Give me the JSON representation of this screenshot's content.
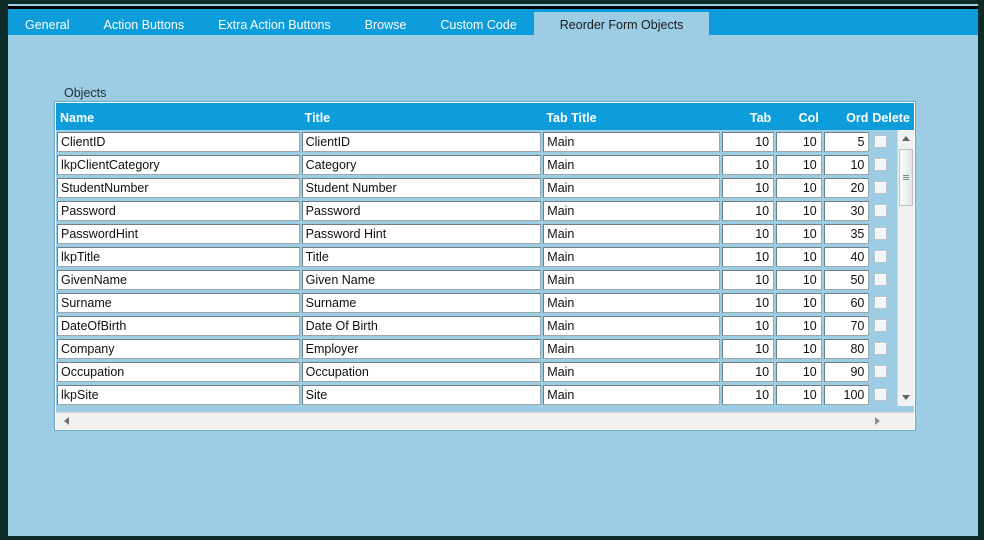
{
  "window": {
    "background_color": "#9ccde4",
    "accent_color": "#0d9ddb",
    "frame_color": "#0c2b26"
  },
  "tabs": [
    {
      "label": "General",
      "active": false
    },
    {
      "label": "Action Buttons",
      "active": false
    },
    {
      "label": "Extra Action Buttons",
      "active": false
    },
    {
      "label": "Browse",
      "active": false
    },
    {
      "label": "Custom Code",
      "active": false
    },
    {
      "label": "Reorder Form Objects",
      "active": true
    }
  ],
  "main": {
    "section_label": "Objects",
    "grid": {
      "columns": [
        {
          "key": "name",
          "header": "Name",
          "align": "left"
        },
        {
          "key": "title",
          "header": "Title",
          "align": "left"
        },
        {
          "key": "tab_title",
          "header": "Tab Title",
          "align": "left"
        },
        {
          "key": "tab",
          "header": "Tab",
          "align": "right"
        },
        {
          "key": "col",
          "header": "Col",
          "align": "right"
        },
        {
          "key": "ord",
          "header": "Ord",
          "align": "right"
        },
        {
          "key": "delete",
          "header": "Delete",
          "align": "left"
        }
      ],
      "rows": [
        {
          "name": "ClientID",
          "title": "ClientID",
          "tab_title": "Main",
          "tab": "10",
          "col": "10",
          "ord": "5",
          "delete": false
        },
        {
          "name": "lkpClientCategory",
          "title": "Category",
          "tab_title": "Main",
          "tab": "10",
          "col": "10",
          "ord": "10",
          "delete": false
        },
        {
          "name": "StudentNumber",
          "title": "Student Number",
          "tab_title": "Main",
          "tab": "10",
          "col": "10",
          "ord": "20",
          "delete": false
        },
        {
          "name": "Password",
          "title": "Password",
          "tab_title": "Main",
          "tab": "10",
          "col": "10",
          "ord": "30",
          "delete": false
        },
        {
          "name": "PasswordHint",
          "title": "Password Hint",
          "tab_title": "Main",
          "tab": "10",
          "col": "10",
          "ord": "35",
          "delete": false
        },
        {
          "name": "lkpTitle",
          "title": "Title",
          "tab_title": "Main",
          "tab": "10",
          "col": "10",
          "ord": "40",
          "delete": false
        },
        {
          "name": "GivenName",
          "title": "Given Name",
          "tab_title": "Main",
          "tab": "10",
          "col": "10",
          "ord": "50",
          "delete": false
        },
        {
          "name": "Surname",
          "title": "Surname",
          "tab_title": "Main",
          "tab": "10",
          "col": "10",
          "ord": "60",
          "delete": false
        },
        {
          "name": "DateOfBirth",
          "title": "Date Of Birth",
          "tab_title": "Main",
          "tab": "10",
          "col": "10",
          "ord": "70",
          "delete": false
        },
        {
          "name": "Company",
          "title": "Employer",
          "tab_title": "Main",
          "tab": "10",
          "col": "10",
          "ord": "80",
          "delete": false
        },
        {
          "name": "Occupation",
          "title": "Occupation",
          "tab_title": "Main",
          "tab": "10",
          "col": "10",
          "ord": "90",
          "delete": false
        },
        {
          "name": "lkpSite",
          "title": "Site",
          "tab_title": "Main",
          "tab": "10",
          "col": "10",
          "ord": "100",
          "delete": false
        }
      ]
    },
    "scrollbars": {
      "vertical": {
        "up_icon": "chevron-up-icon",
        "down_icon": "chevron-down-icon",
        "thumb_position_percent": 5
      },
      "horizontal": {
        "left_icon": "chevron-left-icon",
        "right_icon": "chevron-right-icon"
      }
    }
  }
}
